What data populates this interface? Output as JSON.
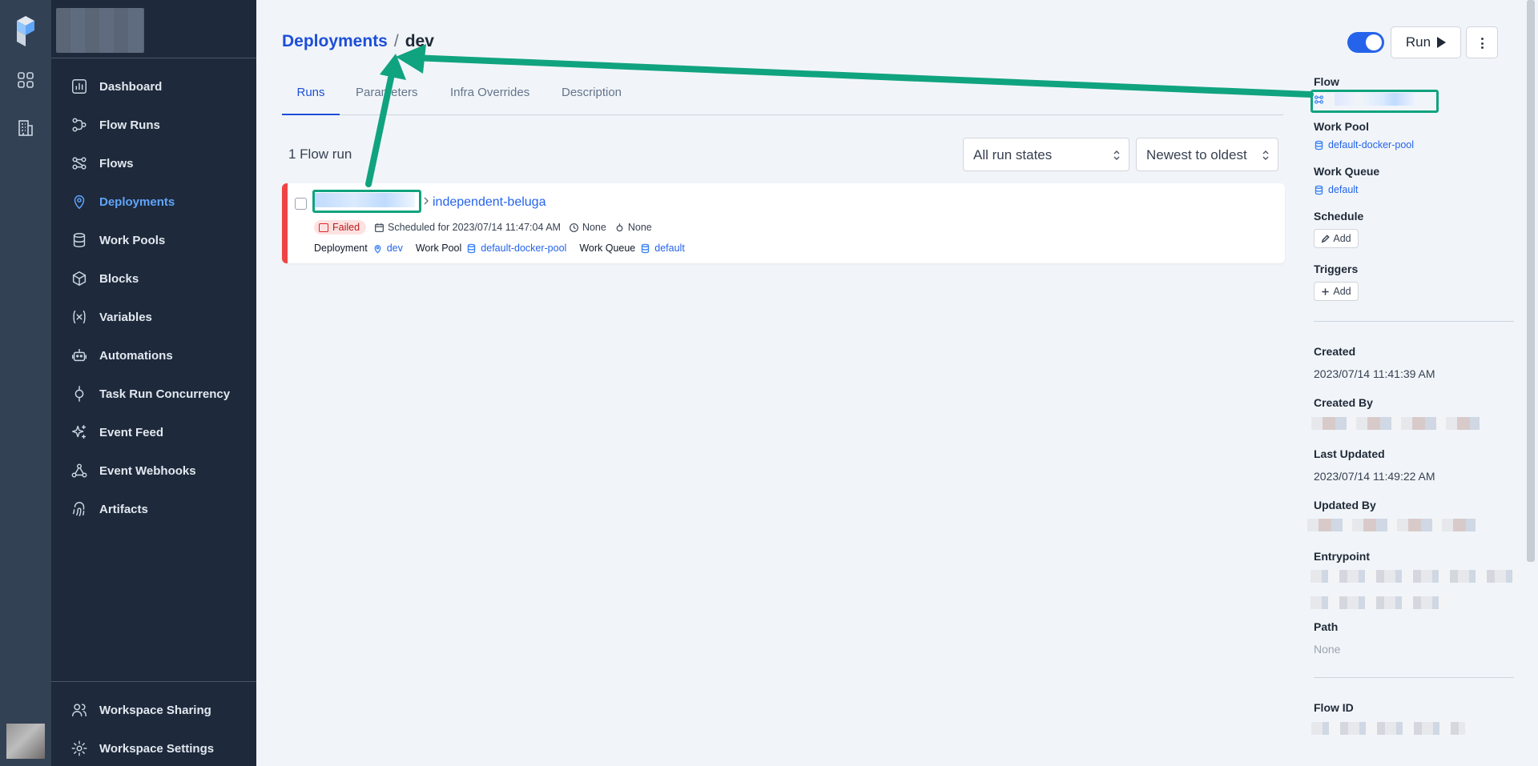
{
  "sidebar": {
    "items": [
      {
        "label": "Dashboard",
        "icon": "dashboard-icon"
      },
      {
        "label": "Flow Runs",
        "icon": "flow-runs-icon"
      },
      {
        "label": "Flows",
        "icon": "flows-icon"
      },
      {
        "label": "Deployments",
        "icon": "map-pin-icon"
      },
      {
        "label": "Work Pools",
        "icon": "database-icon"
      },
      {
        "label": "Blocks",
        "icon": "cube-icon"
      },
      {
        "label": "Variables",
        "icon": "variable-icon"
      },
      {
        "label": "Automations",
        "icon": "robot-icon"
      },
      {
        "label": "Task Run Concurrency",
        "icon": "concurrency-icon"
      },
      {
        "label": "Event Feed",
        "icon": "sparkles-icon"
      },
      {
        "label": "Event Webhooks",
        "icon": "webhook-icon"
      },
      {
        "label": "Artifacts",
        "icon": "fingerprint-icon"
      }
    ],
    "active": "Deployments",
    "bottom_items": [
      {
        "label": "Workspace Sharing",
        "icon": "users-icon"
      },
      {
        "label": "Workspace Settings",
        "icon": "gear-icon"
      }
    ]
  },
  "header": {
    "breadcrumb_parent": "Deployments",
    "breadcrumb_separator": "/",
    "breadcrumb_current": "dev",
    "run_button": "Run",
    "toggle_on": true
  },
  "tabs": [
    "Runs",
    "Parameters",
    "Infra Overrides",
    "Description"
  ],
  "runs": {
    "count_text": "1 Flow run",
    "state_filter": "All run states",
    "sort": "Newest to oldest",
    "items": [
      {
        "name": "independent-beluga",
        "state": "Failed",
        "scheduled": "Scheduled for 2023/07/14 11:47:04 AM",
        "duration": "None",
        "task_runs": "None",
        "deployment_label": "Deployment",
        "deployment": "dev",
        "work_pool_label": "Work Pool",
        "work_pool": "default-docker-pool",
        "work_queue_label": "Work Queue",
        "work_queue": "default"
      }
    ]
  },
  "details": {
    "flow_label": "Flow",
    "work_pool_label": "Work Pool",
    "work_pool": "default-docker-pool",
    "work_queue_label": "Work Queue",
    "work_queue": "default",
    "schedule_label": "Schedule",
    "schedule_add": "Add",
    "triggers_label": "Triggers",
    "triggers_add": "Add",
    "created_label": "Created",
    "created": "2023/07/14 11:41:39 AM",
    "created_by_label": "Created By",
    "last_updated_label": "Last Updated",
    "last_updated": "2023/07/14 11:49:22 AM",
    "updated_by_label": "Updated By",
    "entrypoint_label": "Entrypoint",
    "path_label": "Path",
    "path": "None",
    "flow_id_label": "Flow ID"
  },
  "colors": {
    "accent": "#2563eb",
    "sidebar_bg": "#1e293b",
    "rail_bg": "#334155",
    "failed": "#ef4444",
    "annotation": "#10a37f"
  }
}
